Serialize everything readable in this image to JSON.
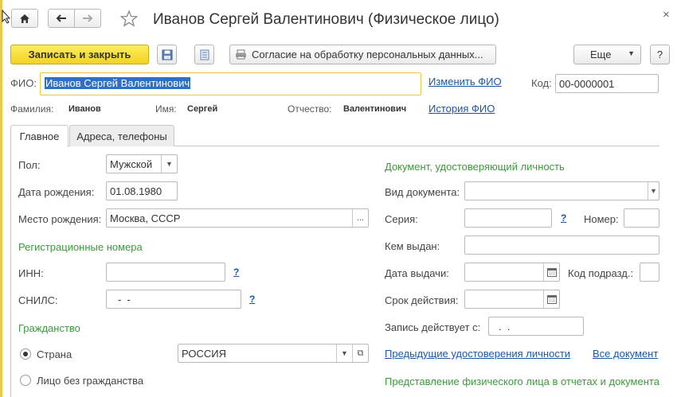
{
  "window": {
    "title": "Иванов Сергей Валентинович (Физическое лицо)",
    "close": "×"
  },
  "toolbar": {
    "save_close": "Записать и закрыть",
    "consent": "Согласие на обработку персональных данных...",
    "more": "Еще",
    "help": "?"
  },
  "fio": {
    "label": "ФИО:",
    "value": "Иванов Сергей Валентинович",
    "change_link": "Изменить ФИО",
    "history_link": "История ФИО"
  },
  "code": {
    "label": "Код:",
    "value": "00-0000001"
  },
  "name_parts": {
    "surname_label": "Фамилия:",
    "surname": "Иванов",
    "name_label": "Имя:",
    "name": "Сергей",
    "patronymic_label": "Отчество:",
    "patronymic": "Валентинович"
  },
  "tabs": [
    {
      "label": "Главное",
      "active": true
    },
    {
      "label": "Адреса, телефоны",
      "active": false
    }
  ],
  "main": {
    "gender_label": "Пол:",
    "gender": "Мужской",
    "birthdate_label": "Дата рождения:",
    "birthdate": "01.08.1980",
    "birthplace_label": "Место рождения:",
    "birthplace": "Москва, СССР",
    "ellipsis": "...",
    "reg_section": "Регистрационные номера",
    "inn_label": "ИНН:",
    "inn": "",
    "snils_label": "СНИЛС:",
    "snils": "-  -",
    "q": "?",
    "citizenship_section": "Гражданство",
    "country_label": "Страна",
    "country": "РОССИЯ",
    "stateless_label": "Лицо без гражданства"
  },
  "document": {
    "section": "Документ, удостоверяющий личность",
    "type_label": "Вид документа:",
    "type": "",
    "series_label": "Серия:",
    "series": "",
    "number_label": "Номер:",
    "number": "",
    "issued_by_label": "Кем выдан:",
    "issued_by": "",
    "issue_date_label": "Дата выдачи:",
    "issue_date": ".  .",
    "dept_code_label": "Код подразд.:",
    "valid_label": "Срок действия:",
    "valid": ".  .",
    "record_valid_label": "Запись действует с:",
    "record_valid": ".  .",
    "prev_link": "Предыдущие удостоверения личности",
    "all_link": "Все документ",
    "repr_section": "Представление физического лица в отчетах и документах"
  },
  "colors": {
    "accent": "#f3d323",
    "link": "#1c56a7",
    "section": "#3b9a3b"
  }
}
